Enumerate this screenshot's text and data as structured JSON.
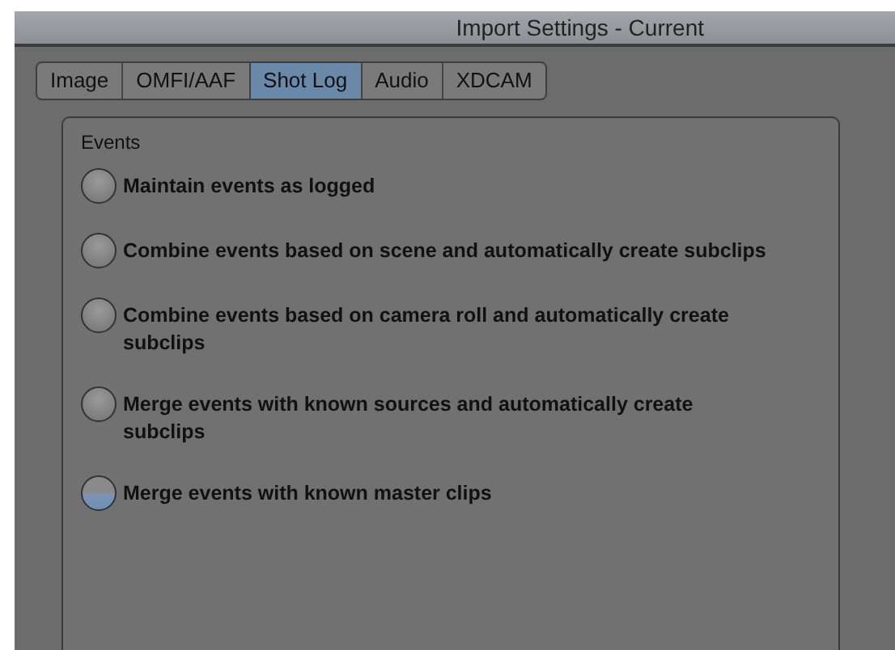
{
  "window": {
    "title": "Import Settings - Current"
  },
  "tabs": [
    {
      "label": "Image",
      "selected": false
    },
    {
      "label": "OMFI/AAF",
      "selected": false
    },
    {
      "label": "Shot Log",
      "selected": true
    },
    {
      "label": "Audio",
      "selected": false
    },
    {
      "label": "XDCAM",
      "selected": false
    }
  ],
  "events": {
    "title": "Events",
    "options": [
      {
        "label": "Maintain events as logged",
        "selected": false
      },
      {
        "label": "Combine events based on scene and automatically create subclips",
        "selected": false
      },
      {
        "label": "Combine events based on camera roll and automatically create subclips",
        "selected": false
      },
      {
        "label": "Merge events with known sources and automatically create subclips",
        "selected": false
      },
      {
        "label": "Merge events with known master clips",
        "selected": true
      }
    ]
  }
}
